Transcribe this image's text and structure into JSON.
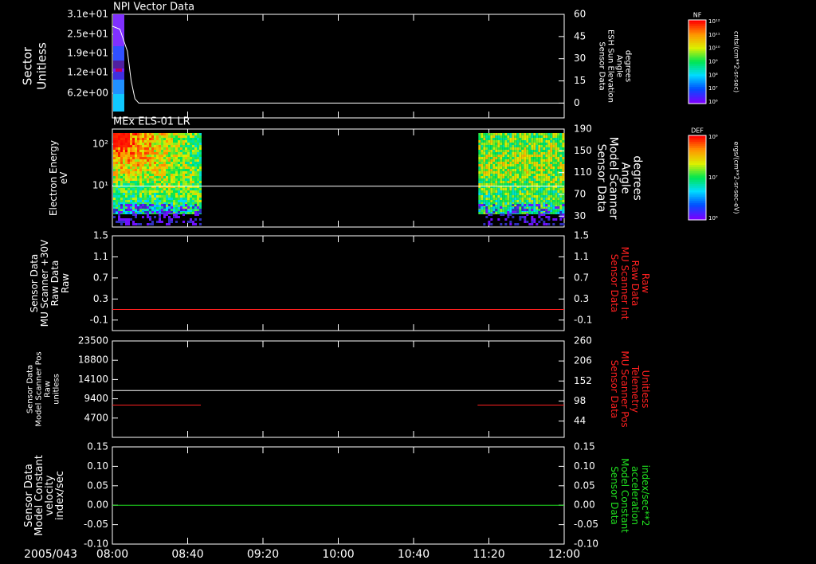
{
  "date_label": "2005/043",
  "time_ticks": [
    "08:00",
    "08:40",
    "09:20",
    "10:00",
    "10:40",
    "11:20",
    "12:00"
  ],
  "colorbars": [
    {
      "tag": "NF",
      "unit": "cnts/(cm**2-sr-sec)",
      "tick_labels": [
        "10¹²",
        "10¹¹",
        "10¹⁰",
        "10⁹",
        "10⁸",
        "10⁷",
        "10⁶"
      ]
    },
    {
      "tag": "DEF",
      "unit": "ergs/(cm**2-sr-sec-eV)",
      "tick_labels": [
        "10⁸",
        "10⁷",
        "10⁶"
      ]
    }
  ],
  "colors": {
    "frame": "#ffffff",
    "red_trace": "#ff2020",
    "green_trace": "#20e020",
    "white_trace": "#ffffff"
  },
  "chart_data": [
    {
      "type": "heatmap",
      "title": "NPI Vector Data",
      "ylabel_lines": [
        "Sector",
        "Unitless"
      ],
      "y_tick_labels": [
        "3.1e+01",
        "2.5e+01",
        "1.9e+01",
        "1.2e+01",
        "6.2e+00"
      ],
      "right_ylabel_lines": [
        "Sensor Data",
        "ESH Sun Elevation",
        "Angle",
        "degrees"
      ],
      "right_ylim": [
        -10,
        60
      ],
      "right_ticks": [
        60,
        45,
        30,
        15,
        0
      ],
      "series": [
        {
          "name": "Sensor Data ESH Sun Elevation Angle",
          "x": [
            "08:00",
            "08:04",
            "08:08",
            "08:10",
            "08:12",
            "08:14",
            "12:00"
          ],
          "y": [
            52,
            50,
            35,
            15,
            3,
            0,
            0
          ]
        }
      ]
    },
    {
      "type": "heatmap",
      "title": "MEx ELS-01 LR",
      "ylabel_lines": [
        "Electron Energy",
        "eV"
      ],
      "y_tick_labels": [
        "10²",
        "10¹"
      ],
      "right_ylabel_lines": [
        "Sensor Data",
        "Model Scanner",
        "Angle",
        "degrees"
      ],
      "right_ylim": [
        10,
        190
      ],
      "right_ticks": [
        190,
        150,
        110,
        70,
        30
      ],
      "data_intervals": [
        [
          "08:00",
          "08:47"
        ],
        [
          "11:14",
          "12:00"
        ]
      ],
      "series": [
        {
          "name": "Sensor Data Model Scanner Angle",
          "x": [
            "08:00",
            "12:00"
          ],
          "y": [
            85,
            85
          ]
        }
      ]
    },
    {
      "type": "line",
      "ylabel_lines": [
        "Sensor Data",
        "MU Scanner +30V",
        "Raw Data",
        "Raw"
      ],
      "ylim": [
        -0.3,
        1.5
      ],
      "y_ticks": [
        "1.5",
        "1.1",
        "0.7",
        "0.3",
        "-0.1"
      ],
      "right_ylabel_lines": [
        "Sensor Data",
        "MU Scanner Int",
        "Raw Data",
        "Raw"
      ],
      "right_ticks": [
        "1.5",
        "1.1",
        "0.7",
        "0.3",
        "-0.1"
      ],
      "series": [
        {
          "name": "Sensor Data MU Scanner Int Raw Data",
          "x": [
            "08:00",
            "12:00"
          ],
          "y": [
            0.1,
            0.1
          ]
        }
      ]
    },
    {
      "type": "line",
      "ylabel_lines": [
        "Sensor Data",
        "Model Scanner Pos",
        "Raw",
        "unitless"
      ],
      "ylim": [
        0,
        23500
      ],
      "y_ticks": [
        "23500",
        "18800",
        "14100",
        "9400",
        "4700"
      ],
      "right_ylabel_lines": [
        "Sensor Data",
        "MU Scanner Pos",
        "Telemetry",
        "Unitless"
      ],
      "right_ylim": [
        0,
        260
      ],
      "right_ticks": [
        "260",
        "206",
        "152",
        "98",
        "44"
      ],
      "series": [
        {
          "name": "Sensor Data Model Scanner Pos Raw",
          "x": [
            "08:00",
            "12:00"
          ],
          "y": [
            11400,
            11400
          ]
        },
        {
          "name": "Sensor Data MU Scanner Pos Telemetry",
          "segments": [
            {
              "x": [
                "08:00",
                "08:47"
              ],
              "y": [
                87,
                87
              ]
            },
            {
              "x": [
                "11:14",
                "12:00"
              ],
              "y": [
                87,
                87
              ]
            }
          ]
        }
      ]
    },
    {
      "type": "line",
      "ylabel_lines": [
        "Sensor Data",
        "Model Constant",
        "velocity",
        "index/sec"
      ],
      "ylim": [
        -0.1,
        0.15
      ],
      "y_ticks": [
        "0.15",
        "0.10",
        "0.05",
        "0.00",
        "-0.05",
        "-0.10"
      ],
      "right_ylabel_lines": [
        "Sensor Data",
        "Model Constant",
        "acceleration",
        "index/sec**2"
      ],
      "right_ticks": [
        "0.15",
        "0.10",
        "0.05",
        "0.00",
        "-0.05",
        "-0.10"
      ],
      "series": [
        {
          "name": "Sensor Data Model Constant acceleration",
          "x": [
            "08:00",
            "12:00"
          ],
          "y": [
            0,
            0
          ]
        }
      ]
    }
  ]
}
